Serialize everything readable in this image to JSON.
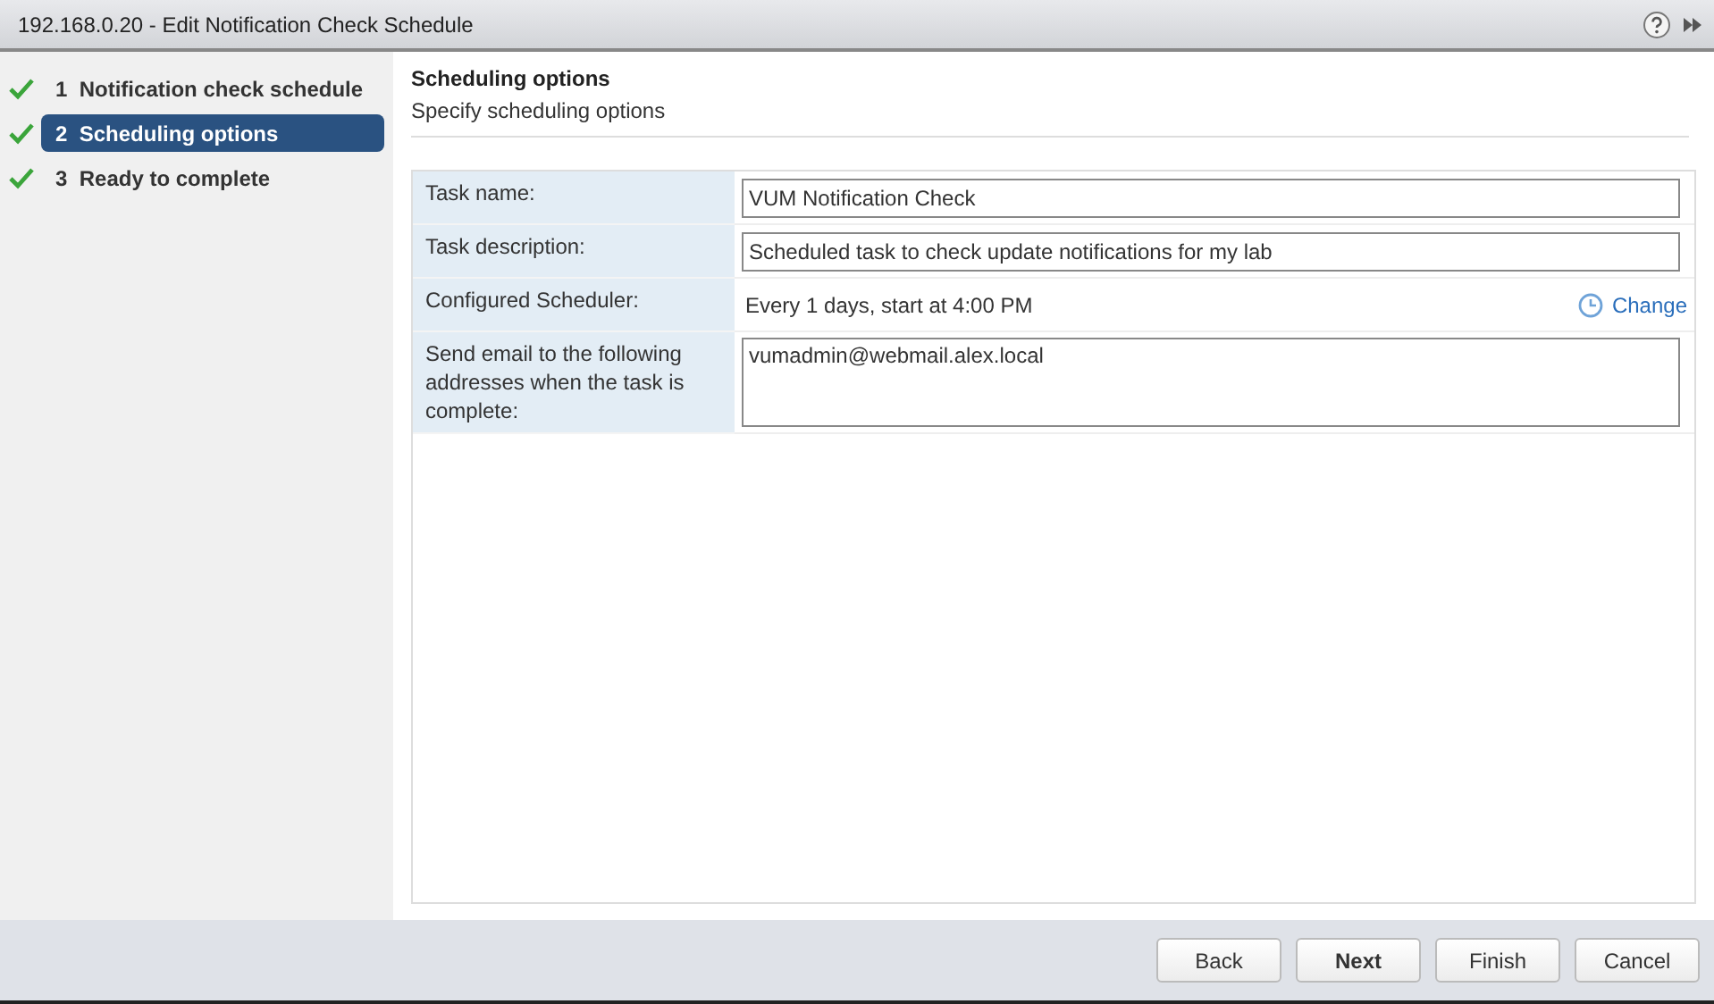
{
  "window": {
    "title": "192.168.0.20 - Edit Notification Check Schedule"
  },
  "steps": [
    {
      "number": "1",
      "label": "Notification check schedule",
      "done": true,
      "selected": false
    },
    {
      "number": "2",
      "label": "Scheduling options",
      "done": true,
      "selected": true
    },
    {
      "number": "3",
      "label": "Ready to complete",
      "done": true,
      "selected": false
    }
  ],
  "page": {
    "heading": "Scheduling options",
    "subheading": "Specify scheduling options"
  },
  "fields": [
    {
      "kind": "input",
      "label": "Task name:",
      "value": "VUM Notification Check"
    },
    {
      "kind": "input",
      "label": "Task description:",
      "value": "Scheduled task to check update notifications for my lab"
    },
    {
      "kind": "text",
      "label": "Configured Scheduler:",
      "value": "Every 1 days, start at 4:00 PM",
      "action": "Change"
    },
    {
      "kind": "textarea",
      "label": "Send email to the following addresses when the task is complete:",
      "value": "vumadmin@webmail.alex.local"
    }
  ],
  "buttons": [
    {
      "label": "Back",
      "default": false
    },
    {
      "label": "Next",
      "default": true
    },
    {
      "label": "Finish",
      "default": false
    },
    {
      "label": "Cancel",
      "default": false
    }
  ]
}
